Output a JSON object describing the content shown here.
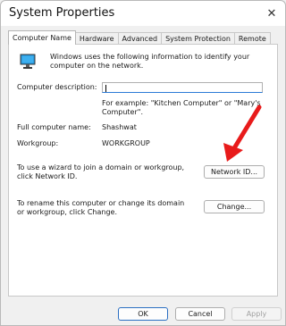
{
  "window": {
    "title": "System Properties",
    "close_glyph": "✕"
  },
  "tabs": [
    {
      "label": "Computer Name",
      "active": true
    },
    {
      "label": "Hardware"
    },
    {
      "label": "Advanced"
    },
    {
      "label": "System Protection"
    },
    {
      "label": "Remote"
    }
  ],
  "panel": {
    "intro": "Windows uses the following information to identify your computer on the network.",
    "description_label": "Computer description:",
    "description_value": "",
    "example_text": "For example: \"Kitchen Computer\" or \"Mary's Computer\".",
    "full_name_label": "Full computer name:",
    "full_name_value": "Shashwat",
    "workgroup_label": "Workgroup:",
    "workgroup_value": "WORKGROUP",
    "network_text": "To use a wizard to join a domain or workgroup, click Network ID.",
    "network_button": "Network ID...",
    "rename_text": "To rename this computer or change its domain or workgroup, click Change.",
    "change_button": "Change..."
  },
  "footer": {
    "ok": "OK",
    "cancel": "Cancel",
    "apply": "Apply"
  },
  "colors": {
    "accent": "#2b6fc2",
    "arrow": "#e81b1b",
    "monitor": "#1e90d6"
  },
  "icons": {
    "computer": "monitor-icon",
    "close": "close-icon"
  }
}
